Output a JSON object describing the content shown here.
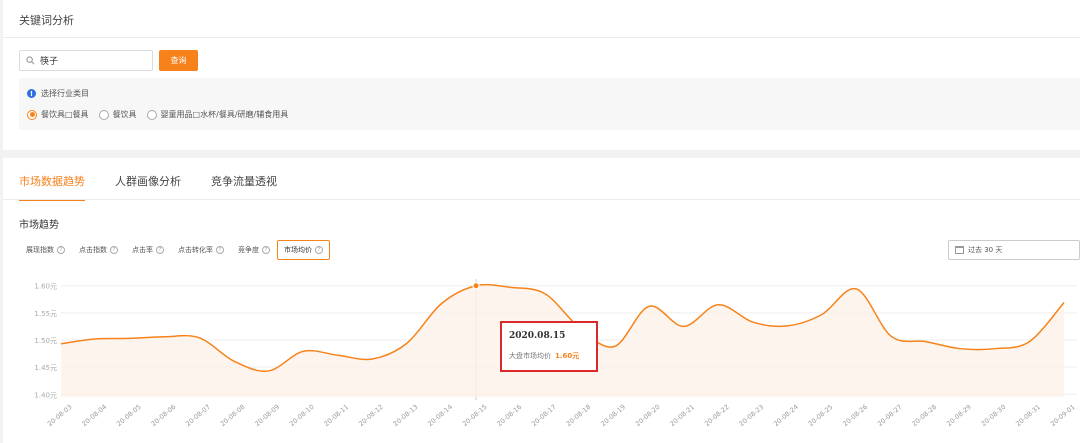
{
  "top": {
    "title": "关键词分析",
    "search": {
      "value": "筷子",
      "placeholder": "",
      "icon": "search-icon"
    },
    "query_button": "查询",
    "category_hint": "选择行业类目",
    "categories": [
      {
        "label": "餐饮具□餐具",
        "checked": true
      },
      {
        "label": "餐饮具",
        "checked": false
      },
      {
        "label": "婴童用品□水杯/餐具/研磨/辅食用具",
        "checked": false
      }
    ]
  },
  "tabs": [
    {
      "label": "市场数据趋势",
      "active": true
    },
    {
      "label": "人群画像分析",
      "active": false
    },
    {
      "label": "竞争流量透视",
      "active": false
    }
  ],
  "section_title": "市场趋势",
  "metrics": [
    {
      "label": "展现指数",
      "active": false
    },
    {
      "label": "点击指数",
      "active": false
    },
    {
      "label": "点击率",
      "active": false
    },
    {
      "label": "点击转化率",
      "active": false
    },
    {
      "label": "竞争度",
      "active": false
    },
    {
      "label": "市场均价",
      "active": true
    }
  ],
  "date_range": "过去 30 天",
  "accent_color": "#f7821b",
  "tooltip": {
    "date": "2020.08.15",
    "label": "大盘市场均价",
    "value": "1.60元"
  },
  "chart_data": {
    "type": "area",
    "title": "",
    "xlabel": "",
    "ylabel": "",
    "ylim": [
      1.395,
      1.605
    ],
    "yticks": [
      "1.40元",
      "1.45元",
      "1.50元",
      "1.55元",
      "1.60元"
    ],
    "ytick_values": [
      1.4,
      1.45,
      1.5,
      1.55,
      1.6
    ],
    "categories": [
      "20-08-03",
      "20-08-04",
      "20-08-05",
      "20-08-06",
      "20-08-07",
      "20-08-08",
      "20-08-09",
      "20-08-10",
      "20-08-11",
      "20-08-12",
      "20-08-13",
      "20-08-14",
      "20-08-15",
      "20-08-16",
      "20-08-17",
      "20-08-18",
      "20-08-19",
      "20-08-20",
      "20-08-21",
      "20-08-22",
      "20-08-23",
      "20-08-24",
      "20-08-25",
      "20-08-26",
      "20-08-27",
      "20-08-28",
      "20-08-29",
      "20-08-30",
      "20-08-31",
      "20-09-01"
    ],
    "series": [
      {
        "color": "#f7821b",
        "values": [
          1.493,
          1.502,
          1.503,
          1.506,
          1.504,
          1.461,
          1.443,
          1.479,
          1.472,
          1.465,
          1.494,
          1.567,
          1.6,
          1.597,
          1.585,
          1.522,
          1.488,
          1.562,
          1.525,
          1.565,
          1.533,
          1.526,
          1.547,
          1.594,
          1.507,
          1.497,
          1.484,
          1.484,
          1.497,
          1.569
        ]
      }
    ],
    "highlight_index": 12
  }
}
